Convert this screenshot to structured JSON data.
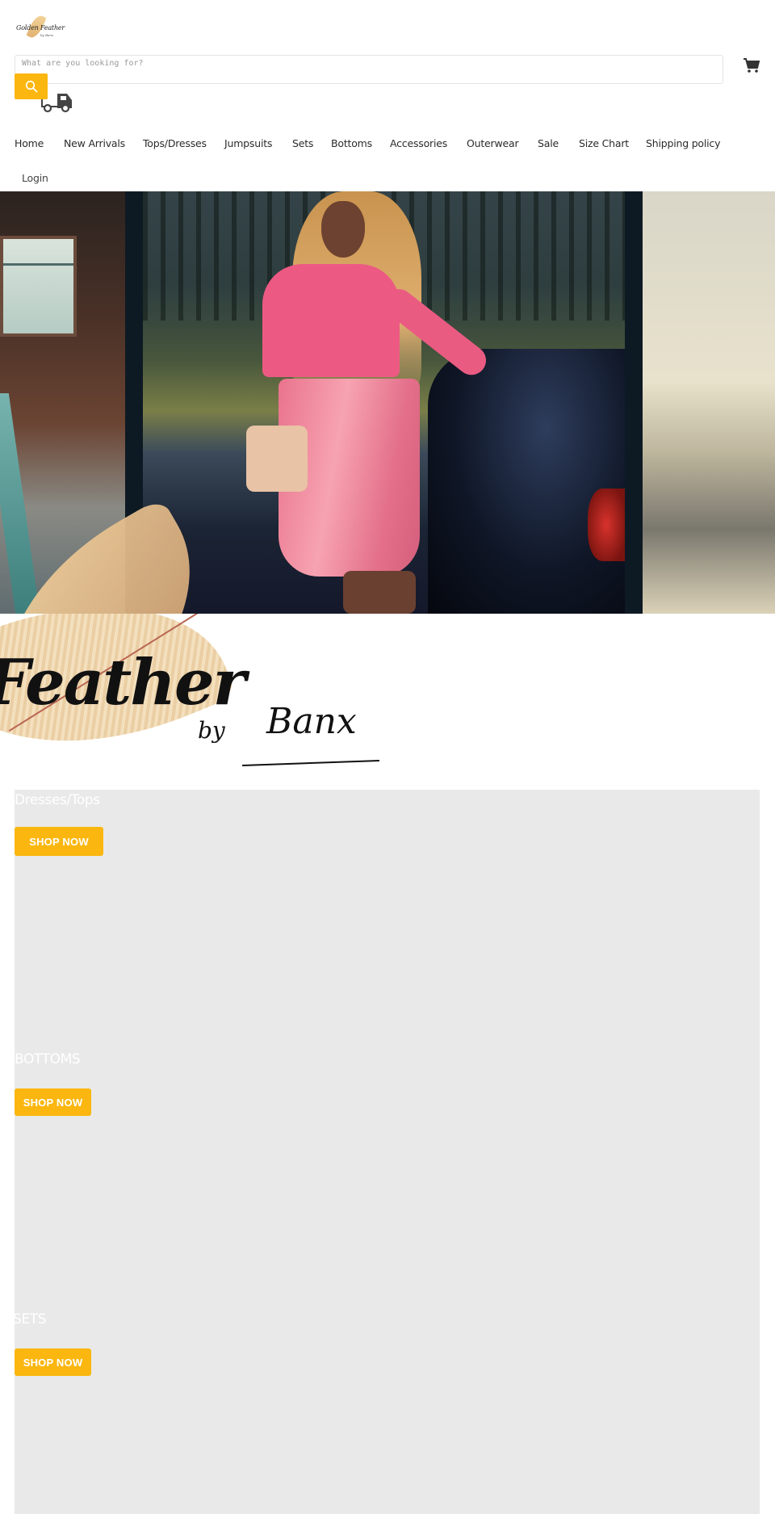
{
  "header": {
    "logo": {
      "text": "Golden Feather",
      "subtext": "by Banx"
    },
    "search": {
      "placeholder": "What are you looking for?",
      "value": "",
      "button_icon": "search-icon"
    },
    "icons": {
      "shipping": "truck-icon",
      "cart": "cart-icon"
    },
    "accent_color": "#fbb710"
  },
  "nav": {
    "items": [
      {
        "label": "Home"
      },
      {
        "label": "New Arrivals"
      },
      {
        "label": "Tops/Dresses"
      },
      {
        "label": "Jumpsuits"
      },
      {
        "label": "Sets"
      },
      {
        "label": "Bottoms"
      },
      {
        "label": "Accessories"
      },
      {
        "label": "Outerwear"
      },
      {
        "label": "Sale"
      },
      {
        "label": "Size Chart"
      },
      {
        "label": "Shipping policy"
      }
    ],
    "login": "Login"
  },
  "hero": {
    "alt": "Model in pink top and pink vinyl pencil skirt standing next to a dark car"
  },
  "brand_banner": {
    "title": "Feather",
    "by": "by",
    "name": "Banx"
  },
  "collections": [
    {
      "title": "Dresses/Tops",
      "button": "SHOP NOW"
    },
    {
      "title": "BOTTOMS",
      "button": "SHOP NOW"
    },
    {
      "title": "SETS",
      "button": "SHOP NOW"
    }
  ]
}
